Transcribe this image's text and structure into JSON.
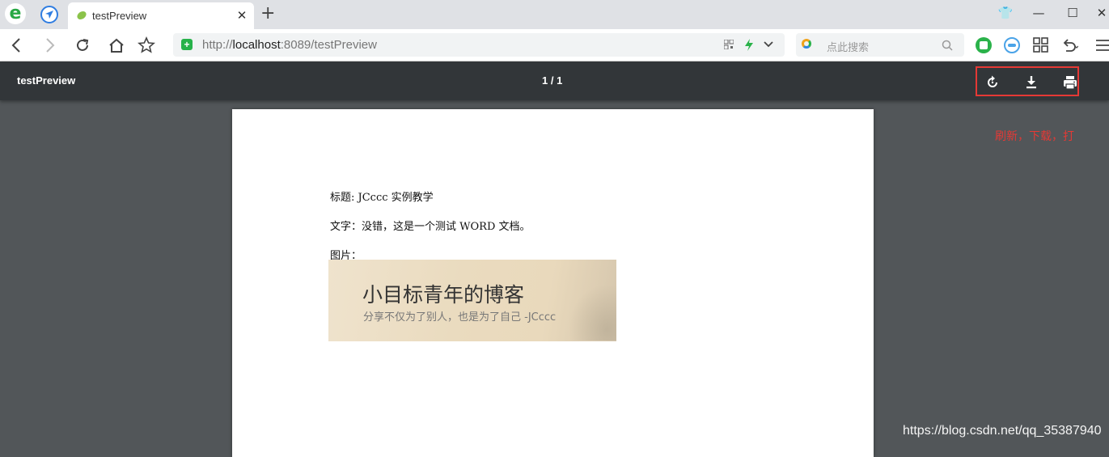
{
  "tab": {
    "title": "testPreview",
    "close": "✕",
    "new": "+"
  },
  "window_controls": {
    "skin": "👕",
    "minimize": "—",
    "maximize": "☐",
    "close": "✕"
  },
  "address": {
    "prefix": "http://",
    "host": "localhost",
    "rest": ":8089/testPreview"
  },
  "search": {
    "placeholder": "点此搜索"
  },
  "viewer": {
    "title": "testPreview",
    "page_indicator": "1 / 1",
    "annotation": "刷新，下载，打"
  },
  "document": {
    "title_line": "标题: JCccc 实例教学",
    "text_line": "文字：没错，这是一个测试  WORD 文档。",
    "image_label": "图片：",
    "banner_title": "小目标青年的博客",
    "banner_subtitle": "分享不仅为了别人，也是为了自己 -JCccc"
  },
  "watermark": "https://blog.csdn.net/qq_35387940",
  "colors": {
    "viewer_toolbar": "#323639",
    "viewer_bg": "#525659",
    "highlight": "#e53935"
  }
}
